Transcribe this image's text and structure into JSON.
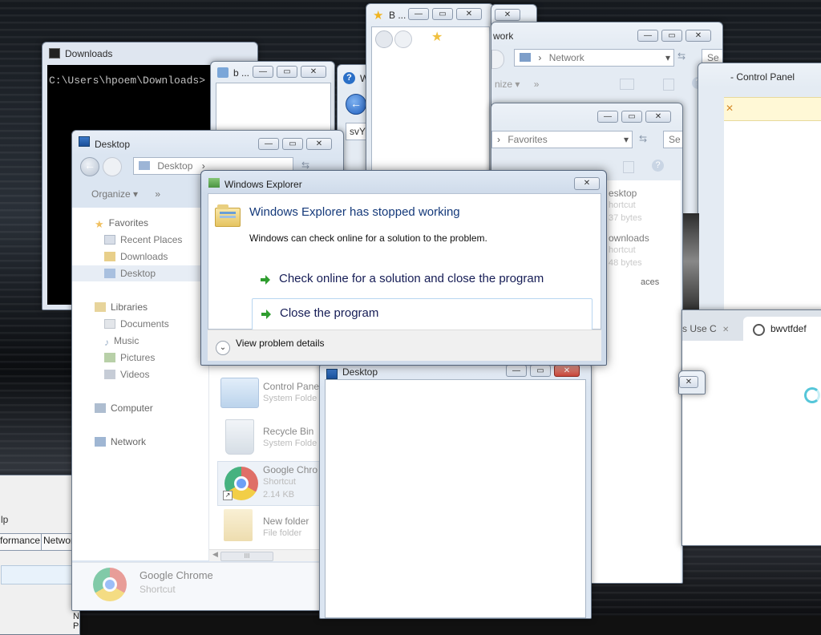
{
  "console": {
    "title": "Downloads",
    "prompt": "C:\\Users\\hpoem\\Downloads>"
  },
  "small_window_b": {
    "title": "b ..."
  },
  "help_window": {
    "title_prefix": "W",
    "field_value": "svY"
  },
  "favorites_popup": {
    "title": "B ..."
  },
  "network_window": {
    "title": "work",
    "address": "Network",
    "search": "Se",
    "organize": "nize",
    "expand": "»"
  },
  "control_panel_window": {
    "title": "- Control Panel"
  },
  "favorites_window": {
    "address": "Favorites",
    "search": "Se",
    "items": [
      {
        "name": "esktop",
        "sub1": "hortcut",
        "sub2": "37 bytes"
      },
      {
        "name": "ownloads",
        "sub1": "hortcut",
        "sub2": "48 bytes"
      },
      {
        "name": "aces",
        "sub1": "",
        "sub2": ""
      }
    ]
  },
  "explorer_desktop": {
    "title": "Desktop",
    "address": "Desktop",
    "organize": "Organize",
    "expand": "»",
    "nav": {
      "favorites": "Favorites",
      "recent_places": "Recent Places",
      "downloads": "Downloads",
      "desktop": "Desktop",
      "libraries": "Libraries",
      "documents": "Documents",
      "music": "Music",
      "pictures": "Pictures",
      "videos": "Videos",
      "computer": "Computer",
      "network": "Network"
    },
    "files": [
      {
        "name": "Control Pane",
        "sub1": "System Folde",
        "sub2": ""
      },
      {
        "name": "Recycle Bin",
        "sub1": "System Folde",
        "sub2": ""
      },
      {
        "name": "Google Chro",
        "sub1": "Shortcut",
        "sub2": "2.14 KB"
      },
      {
        "name": "New folder",
        "sub1": "File folder",
        "sub2": ""
      }
    ],
    "details": {
      "name": "Google Chrome",
      "type": "Shortcut"
    }
  },
  "task_manager": {
    "menu": "lp",
    "tabs": [
      "formance",
      "Network"
    ],
    "column": "Net Po"
  },
  "desktop_window2": {
    "title": "Desktop"
  },
  "browser": {
    "tab_partial": "s Use C",
    "tab_title": "bwvtfdef"
  },
  "dialog": {
    "title": "Windows Explorer",
    "heading": "Windows Explorer has stopped working",
    "message": "Windows can check online for a solution to the problem.",
    "option_check": "Check online for a solution and close the program",
    "option_close": "Close the program",
    "details_toggle": "View problem details",
    "close_glyph": "✕"
  },
  "glyphs": {
    "minimize": "—",
    "maximize": "▭",
    "close": "✕",
    "refresh": "⇆",
    "dropdown": "▾",
    "scroll_mid": "III"
  }
}
